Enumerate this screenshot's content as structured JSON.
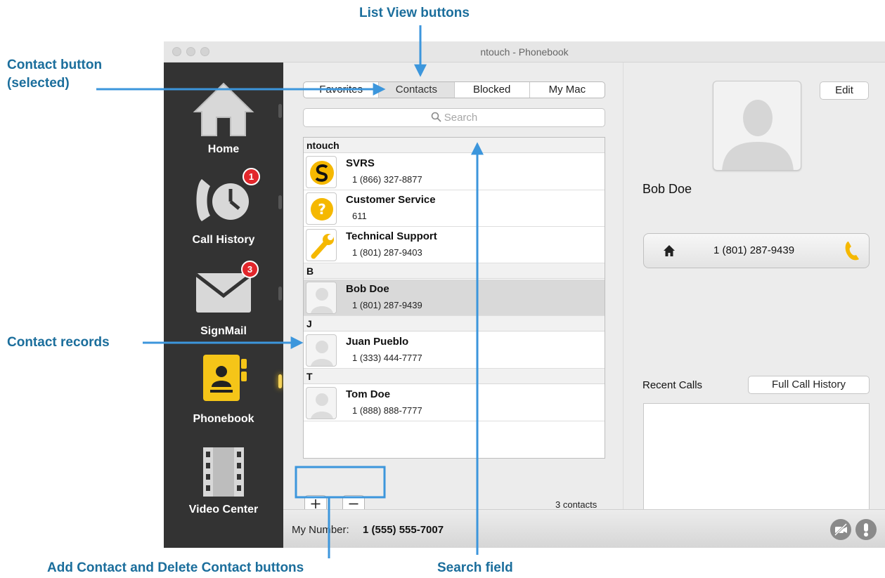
{
  "callouts": {
    "list_view": "List View buttons",
    "contact_button_line1": "Contact button",
    "contact_button_line2": "(selected)",
    "contact_records": "Contact records",
    "add_delete": "Add Contact and Delete Contact buttons",
    "search_field": "Search field"
  },
  "window": {
    "title": "ntouch - Phonebook"
  },
  "sidebar": {
    "items": [
      {
        "label": "Home",
        "icon": "home-icon"
      },
      {
        "label": "Call History",
        "icon": "call-history-icon",
        "badge": "1"
      },
      {
        "label": "SignMail",
        "icon": "envelope-icon",
        "badge": "3"
      },
      {
        "label": "Phonebook",
        "icon": "phonebook-icon",
        "active": true
      },
      {
        "label": "Video Center",
        "icon": "film-icon"
      }
    ]
  },
  "tabs": [
    "Favorites",
    "Contacts",
    "Blocked",
    "My Mac"
  ],
  "selected_tab": "Contacts",
  "search": {
    "placeholder": "Search"
  },
  "sections": [
    {
      "header": "ntouch",
      "contacts": [
        {
          "name": "SVRS",
          "number": "1 (866) 327-8877",
          "icon": "svrs-logo-icon"
        },
        {
          "name": "Customer Service",
          "number": "611",
          "icon": "question-icon"
        },
        {
          "name": "Technical Support",
          "number": "1 (801) 287-9403",
          "icon": "wrench-icon"
        }
      ]
    },
    {
      "header": "B",
      "contacts": [
        {
          "name": "Bob Doe",
          "number": "1 (801) 287-9439",
          "icon": "person-silhouette-icon",
          "selected": true
        }
      ]
    },
    {
      "header": "J",
      "contacts": [
        {
          "name": "Juan Pueblo",
          "number": "1 (333) 444-7777",
          "icon": "person-silhouette-icon"
        }
      ]
    },
    {
      "header": "T",
      "contacts": [
        {
          "name": "Tom Doe",
          "number": "1 (888) 888-7777",
          "icon": "person-silhouette-icon"
        }
      ]
    }
  ],
  "list_footer": {
    "add": "+",
    "remove": "−",
    "count": "3 contacts"
  },
  "detail": {
    "edit": "Edit",
    "name": "Bob Doe",
    "phone": "1 (801) 287-9439",
    "recent_calls": "Recent Calls",
    "full_history": "Full Call History"
  },
  "bottom": {
    "my_number_label": "My Number:",
    "my_number": "1 (555) 555-7007"
  },
  "colors": {
    "callout": "#1b6e9c",
    "arrow": "#3c96dc",
    "accent_yellow": "#f5c518",
    "badge_red": "#e2262b",
    "sidebar_bg": "#333333"
  }
}
